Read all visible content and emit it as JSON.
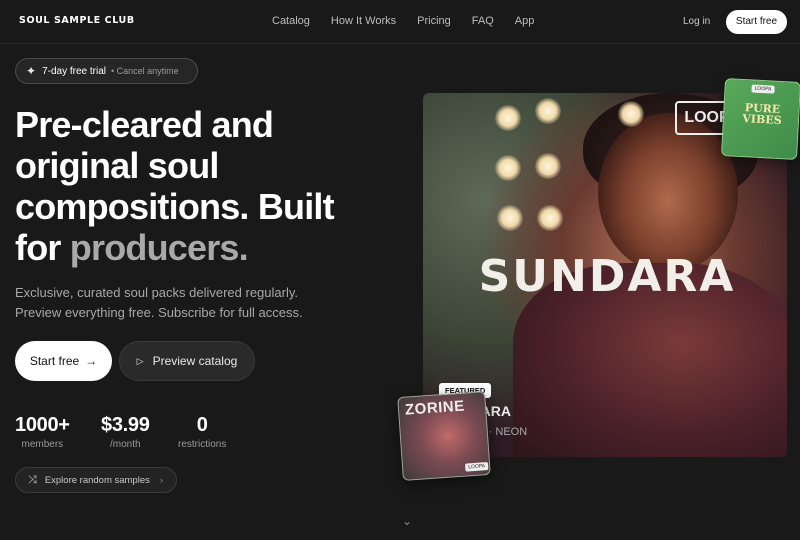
{
  "header": {
    "logo": "SOUL SAMPLE CLUB",
    "nav": [
      "Catalog",
      "How It Works",
      "Pricing",
      "FAQ",
      "App"
    ],
    "login": "Log in",
    "start_free": "Start free"
  },
  "hero": {
    "pill": {
      "trial": "7-day free trial",
      "cancel": "• Cancel anytime"
    },
    "headline_1": "Pre-cleared and original soul compositions. Built",
    "headline_2": "for",
    "headline_accent": "producers.",
    "sub_1": "Exclusive, curated soul packs delivered regularly.",
    "sub_2": "Preview everything free. Subscribe for full access.",
    "start_free": "Start free",
    "preview": "Preview catalog",
    "stats": [
      {
        "num": "1000+",
        "lbl": "members"
      },
      {
        "num": "$3.99",
        "lbl": "/month"
      },
      {
        "num": "0",
        "lbl": "restrictions"
      }
    ],
    "explore": "Explore random samples"
  },
  "featured": {
    "cover_title": "SUNDARA",
    "label_logo": "LOOP",
    "badge": "FEATURED",
    "title": "SUNDARA",
    "meta": "15 tracks · NEON",
    "green_card_text": "PURE VIBES",
    "green_card_tag": "LOOPA",
    "zorine_card_name": "ZORINE",
    "zorine_card_tag": "LOOPA"
  },
  "icons": {
    "spark": "sparkle-icon",
    "arrow": "arrow-right-icon",
    "play": "play-icon",
    "shuffle": "shuffle-icon",
    "chevron": "chevron-right-icon",
    "scroll": "chevron-down-icon"
  }
}
